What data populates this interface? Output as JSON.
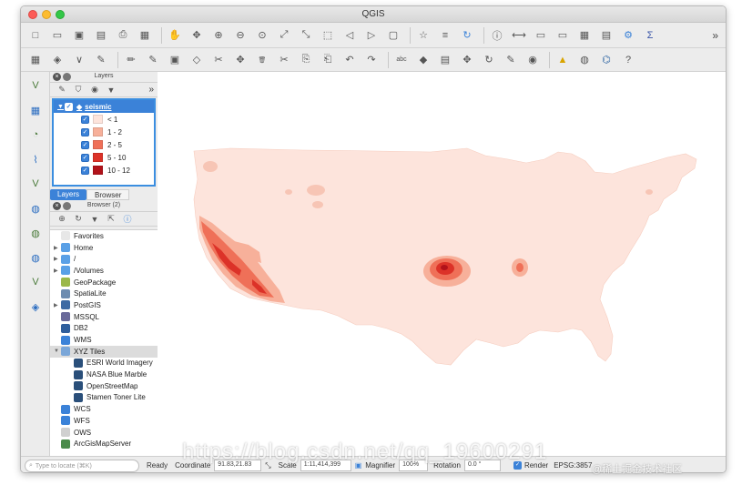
{
  "window": {
    "title": "QGIS"
  },
  "toolbar1": {
    "icons": [
      "new-project-icon",
      "open-project-icon",
      "save-project-icon",
      "save-as-icon",
      "print-layout-icon",
      "layout-manager-icon",
      "pan-icon",
      "pan-to-selection-icon",
      "zoom-in-icon",
      "zoom-out-icon",
      "zoom-native-icon",
      "zoom-full-icon",
      "zoom-to-selection-icon",
      "zoom-to-layer-icon",
      "zoom-last-icon",
      "zoom-next-icon",
      "new-map-view-icon",
      "new-bookmark-icon",
      "show-bookmarks-icon",
      "refresh-icon",
      "identify-icon",
      "measure-icon",
      "select-icon",
      "deselect-icon",
      "attribute-table-icon",
      "field-calculator-icon",
      "settings-icon",
      "statistics-icon"
    ],
    "more": "»"
  },
  "toolbar2": {
    "icons": [
      "data-source-manager-icon",
      "new-geopackage-icon",
      "new-shapefile-icon",
      "digitize-icon",
      "edit-icon",
      "toggle-edit-icon",
      "save-edits-icon",
      "add-feature-icon",
      "vertex-tool-icon",
      "move-feature-icon",
      "delete-icon",
      "cut-icon",
      "copy-icon",
      "paste-icon",
      "undo-icon",
      "redo-icon",
      "label-icon",
      "label-pin-icon",
      "label-highlight-icon",
      "label-move-icon",
      "label-rotate-icon",
      "label-change-icon",
      "label-show-icon",
      "warning-icon",
      "globe-icon",
      "python-icon",
      "help-icon"
    ]
  },
  "left_toolbar": {
    "icons": [
      "add-vector-layer-icon",
      "add-raster-layer-icon",
      "add-spatialite-icon",
      "add-postgis-icon",
      "add-virtual-layer-icon",
      "add-wms-icon",
      "add-wfs-icon",
      "add-wcs-icon",
      "add-xyz-icon",
      "add-arcgis-icon"
    ]
  },
  "layers_panel": {
    "title": "Layers",
    "more": "»",
    "layer": {
      "name": "seismic",
      "checked": true,
      "classes": [
        {
          "label": "< 1",
          "color": "#fde4dc"
        },
        {
          "label": "1 - 2",
          "color": "#f7b09a"
        },
        {
          "label": "2 - 5",
          "color": "#ef7058"
        },
        {
          "label": "5 - 10",
          "color": "#dc3228"
        },
        {
          "label": "10 - 12",
          "color": "#b1121a"
        }
      ]
    },
    "tabs": [
      "Layers",
      "Browser"
    ]
  },
  "browser_panel": {
    "title": "Browser (2)",
    "items": [
      {
        "label": "Favorites",
        "icon": "star-icon",
        "expandable": false,
        "color": "#e7e7e7"
      },
      {
        "label": "Home",
        "icon": "folder-icon",
        "expandable": true,
        "color": "#5aa0e6"
      },
      {
        "label": "/",
        "icon": "folder-icon",
        "expandable": true,
        "color": "#5aa0e6"
      },
      {
        "label": "/Volumes",
        "icon": "folder-icon",
        "expandable": true,
        "color": "#5aa0e6"
      },
      {
        "label": "GeoPackage",
        "icon": "geopackage-icon",
        "expandable": false,
        "color": "#9bb84a"
      },
      {
        "label": "SpatiaLite",
        "icon": "spatialite-icon",
        "expandable": false,
        "color": "#6d8cb0"
      },
      {
        "label": "PostGIS",
        "icon": "postgis-icon",
        "expandable": true,
        "color": "#3d6aa3"
      },
      {
        "label": "MSSQL",
        "icon": "mssql-icon",
        "expandable": false,
        "color": "#6a6a9a"
      },
      {
        "label": "DB2",
        "icon": "db2-icon",
        "expandable": false,
        "color": "#2f5e9c"
      },
      {
        "label": "WMS",
        "icon": "wms-icon",
        "expandable": false,
        "color": "#3b82d8"
      },
      {
        "label": "XYZ Tiles",
        "icon": "xyz-tiles-icon",
        "expandable": true,
        "expanded": true,
        "color": "#7aa6d8"
      },
      {
        "label": "ESRI World Imagery",
        "icon": "tile-layer-icon",
        "sub": true,
        "color": "#2a4f7a"
      },
      {
        "label": "NASA Blue Marble",
        "icon": "tile-layer-icon",
        "sub": true,
        "color": "#2a4f7a"
      },
      {
        "label": "OpenStreetMap",
        "icon": "tile-layer-icon",
        "sub": true,
        "color": "#2a4f7a"
      },
      {
        "label": "Stamen Toner Lite",
        "icon": "tile-layer-icon",
        "sub": true,
        "color": "#2a4f7a"
      },
      {
        "label": "WCS",
        "icon": "wcs-icon",
        "expandable": false,
        "color": "#3b82d8"
      },
      {
        "label": "WFS",
        "icon": "wfs-icon",
        "expandable": false,
        "color": "#3b82d8"
      },
      {
        "label": "OWS",
        "icon": "ows-icon",
        "expandable": false,
        "color": "#d0d0d0"
      },
      {
        "label": "ArcGisMapServer",
        "icon": "arcgis-icon",
        "expandable": false,
        "color": "#4a8a4a"
      }
    ]
  },
  "statusbar": {
    "locator_placeholder": "Type to locate (⌘K)",
    "ready": "Ready",
    "coordinate_label": "Coordinate",
    "coordinate_value": "91.83,21.83",
    "scale_label": "Scale",
    "scale_value": "1:11,414,399",
    "magnifier_label": "Magnifier",
    "magnifier_value": "100%",
    "rotation_label": "Rotation",
    "rotation_value": "0.0 °",
    "render_label": "Render",
    "crs_label": "EPSG:3857"
  },
  "watermark": {
    "url": "https://blog.csdn.net/qq_19600291",
    "site": "@稀土掘金技术社区"
  }
}
